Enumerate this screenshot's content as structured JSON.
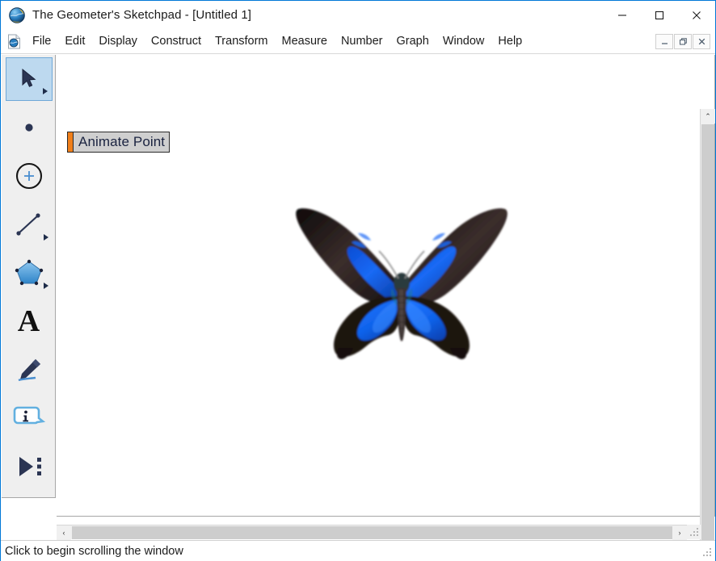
{
  "window": {
    "title": "The Geometer's Sketchpad - [Untitled 1]",
    "app_icon": "sketchpad-globe-icon",
    "controls": {
      "minimize": "minimize-icon",
      "maximize": "maximize-icon",
      "close": "close-icon"
    },
    "accent_color": "#0078d7",
    "background": "#ffffff"
  },
  "menubar": {
    "document_icon": "sketchpad-document-icon",
    "items": [
      {
        "label": "File"
      },
      {
        "label": "Edit"
      },
      {
        "label": "Display"
      },
      {
        "label": "Construct"
      },
      {
        "label": "Transform"
      },
      {
        "label": "Measure"
      },
      {
        "label": "Number"
      },
      {
        "label": "Graph"
      },
      {
        "label": "Window"
      },
      {
        "label": "Help"
      }
    ],
    "mdi_controls": [
      {
        "name": "mdi-minimize",
        "glyph": "–"
      },
      {
        "name": "mdi-restore",
        "glyph": "❐"
      },
      {
        "name": "mdi-close",
        "glyph": "✕"
      }
    ]
  },
  "toolbar": {
    "background": "#efefef",
    "selection_color": "#bdd9ef",
    "tools": [
      {
        "name": "arrow-select-tool",
        "icon": "arrow-cursor-icon",
        "selected": true,
        "has_flyout": true
      },
      {
        "name": "point-tool",
        "icon": "point-icon",
        "selected": false,
        "has_flyout": false
      },
      {
        "name": "compass-tool",
        "icon": "circle-compass-icon",
        "selected": false,
        "has_flyout": false
      },
      {
        "name": "straightedge-tool",
        "icon": "segment-line-icon",
        "selected": false,
        "has_flyout": true
      },
      {
        "name": "polygon-tool",
        "icon": "pentagon-icon",
        "selected": false,
        "has_flyout": true
      },
      {
        "name": "text-tool",
        "icon": "letter-a-icon",
        "selected": false,
        "has_flyout": false
      },
      {
        "name": "marker-tool",
        "icon": "pen-marker-icon",
        "selected": false,
        "has_flyout": false
      },
      {
        "name": "information-tool",
        "icon": "info-bubble-icon",
        "selected": false,
        "has_flyout": false
      },
      {
        "name": "custom-tool",
        "icon": "play-triangle-icon",
        "selected": false,
        "has_flyout": false
      }
    ]
  },
  "canvas": {
    "background": "#ffffff",
    "action_button": {
      "label": "Animate Point",
      "accent_color": "#f07f1a",
      "fill_color": "#cfcfcf",
      "text_color": "#1a2340"
    },
    "image": {
      "name": "butterfly-image",
      "description": "Blue Ulysses swallowtail butterfly",
      "wing_color": "#1464f0",
      "body_color": "#241a19"
    }
  },
  "scrollbars": {
    "vertical": {
      "up_glyph": "⌃",
      "down_glyph": "⌄"
    },
    "horizontal": {
      "left_glyph": "‹",
      "right_glyph": "›"
    }
  },
  "statusbar": {
    "message": "Click to begin scrolling the window"
  }
}
